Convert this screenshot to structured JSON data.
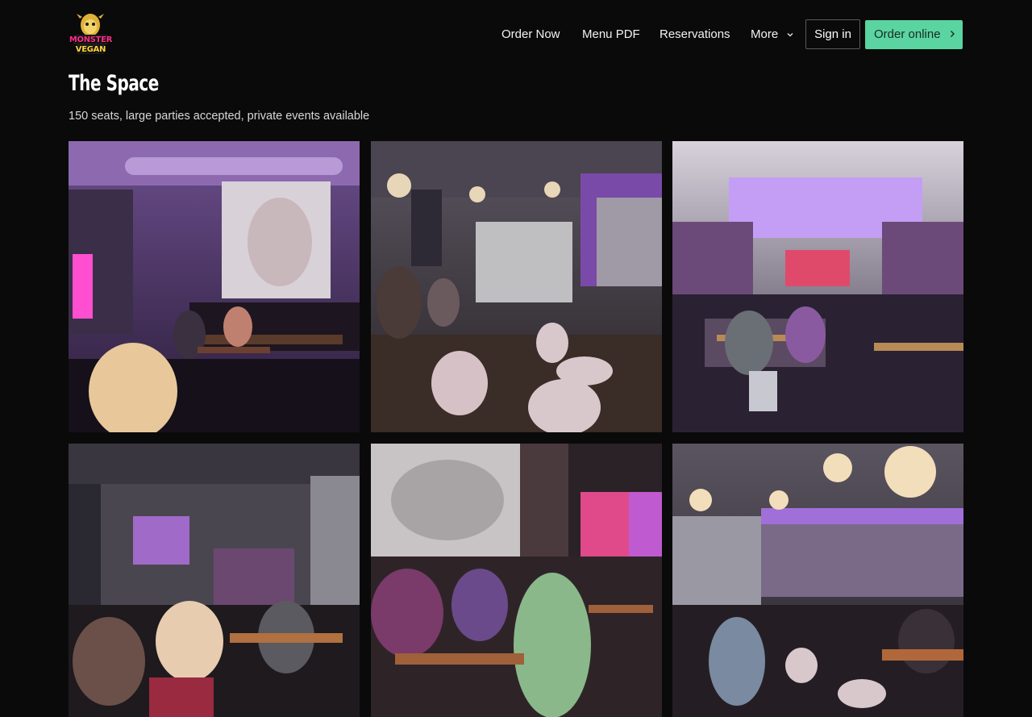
{
  "brand": {
    "logo_line1": "MONSTER",
    "logo_line2": "VEGAN"
  },
  "nav": {
    "links": [
      "Order Now",
      "Menu PDF",
      "Reservations",
      "More"
    ],
    "more_icon": "chevron-down-icon",
    "sign_in": "Sign in",
    "order_online": "Order online",
    "order_online_icon": "chevron-right-icon"
  },
  "section": {
    "title": "The Space",
    "subtitle": "150 seats, large parties accepted, private events available"
  },
  "gallery": {
    "photos": [
      "restaurant-interior-1",
      "restaurant-interior-2",
      "restaurant-interior-3",
      "restaurant-interior-4",
      "restaurant-interior-5",
      "restaurant-interior-6"
    ]
  },
  "colors": {
    "background": "#0a0a0a",
    "accent_green": "#5ad4a0",
    "neon_pink": "#ff2f8a",
    "neon_purple": "#b15cff"
  }
}
